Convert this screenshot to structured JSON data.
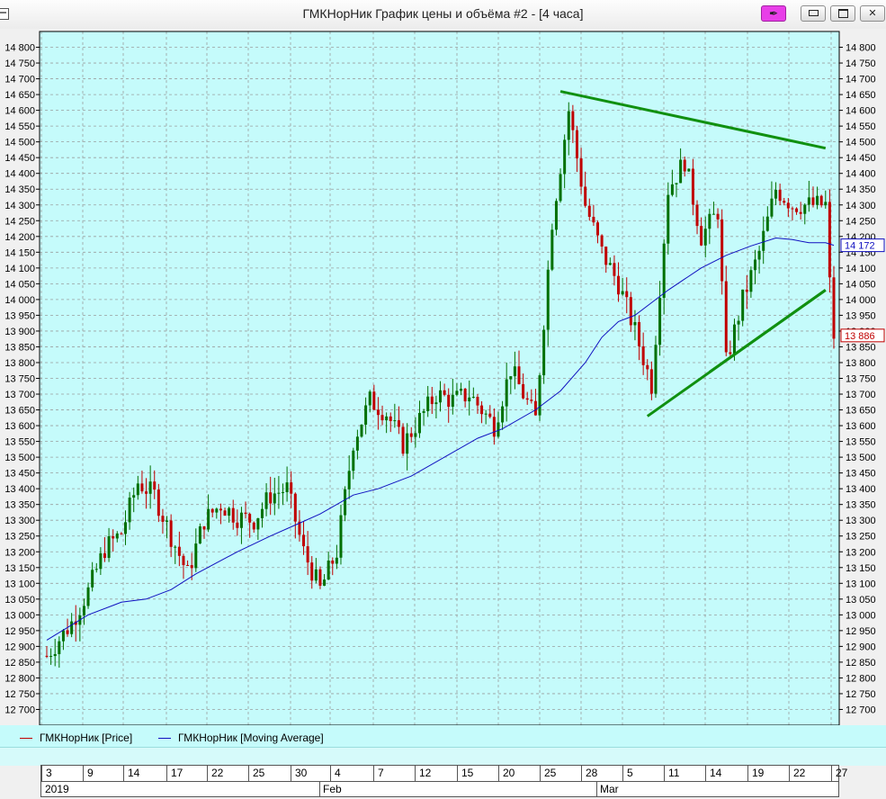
{
  "window": {
    "title": "ГМКНорНик График цены и объёма #2 - [4 часа]",
    "pin_glyph": "✒",
    "controls": [
      "pin-icon",
      "minimize-icon",
      "maximize-icon",
      "close-icon"
    ]
  },
  "colors": {
    "plot_bg": "#c5fbfb",
    "grid": "#9aa0a0",
    "up": "#007000",
    "down": "#c00000",
    "ma": "#1010c0",
    "trend": "#109010",
    "border": "#000000"
  },
  "legend": {
    "price": "ГМКНорНик [Price]",
    "ma": "ГМКНорНик [Moving Average]"
  },
  "time_axis": {
    "day_ticks": [
      "3",
      "9",
      "14",
      "17",
      "22",
      "25",
      "30",
      "4",
      "7",
      "12",
      "15",
      "20",
      "25",
      "28",
      "5",
      "11",
      "14",
      "19",
      "22",
      "27"
    ],
    "months": [
      "2019",
      "Feb",
      "Mar"
    ]
  },
  "chart_data": {
    "type": "candlestick",
    "title": "ГМКНорНик График цены и объёма #2 - [4 часа]",
    "ylim": [
      12650,
      14850
    ],
    "y_ticks": [
      12700,
      12750,
      12800,
      12850,
      12900,
      12950,
      13000,
      13050,
      13100,
      13150,
      13200,
      13250,
      13300,
      13350,
      13400,
      13450,
      13500,
      13550,
      13600,
      13650,
      13700,
      13750,
      13800,
      13850,
      13900,
      13950,
      14000,
      14050,
      14100,
      14150,
      14200,
      14250,
      14300,
      14350,
      14400,
      14450,
      14500,
      14550,
      14600,
      14650,
      14700,
      14750,
      14800
    ],
    "y_tick_labels": [
      "12 700",
      "12 750",
      "12 800",
      "12 850",
      "12 900",
      "12 950",
      "13 000",
      "13 050",
      "13 100",
      "13 150",
      "13 200",
      "13 250",
      "13 300",
      "13 350",
      "13 400",
      "13 450",
      "13 500",
      "13 550",
      "13 600",
      "13 650",
      "13 700",
      "13 750",
      "13 800",
      "13 850",
      "13 900",
      "13 950",
      "14 000",
      "14 050",
      "14 100",
      "14 150",
      "14 200",
      "14 250",
      "14 300",
      "14 350",
      "14 400",
      "14 450",
      "14 500",
      "14 550",
      "14 600",
      "14 650",
      "14 700",
      "14 750",
      "14 800"
    ],
    "grid": true,
    "price_markers": [
      {
        "value": 14172,
        "label": "14 172",
        "series": "ma"
      },
      {
        "value": 13886,
        "label": "13 886",
        "series": "price"
      }
    ],
    "trend_lines": [
      {
        "name": "resistance",
        "from": [
          124,
          14660
        ],
        "to": [
          188,
          14480
        ]
      },
      {
        "name": "support-1",
        "from": [
          145,
          13630
        ],
        "to": [
          188,
          14030
        ]
      },
      {
        "name": "support-2",
        "from": [
          160,
          13770
        ],
        "to": [
          188,
          14030
        ]
      }
    ],
    "series": [
      {
        "name": "ГМКНорНик [Price]",
        "kind": "candles",
        "anchors": [
          [
            0,
            12870
          ],
          [
            6,
            12975
          ],
          [
            10,
            13075
          ],
          [
            14,
            13210
          ],
          [
            18,
            13260
          ],
          [
            22,
            13420
          ],
          [
            26,
            13380
          ],
          [
            30,
            13250
          ],
          [
            34,
            13130
          ],
          [
            38,
            13300
          ],
          [
            42,
            13350
          ],
          [
            46,
            13310
          ],
          [
            50,
            13300
          ],
          [
            54,
            13380
          ],
          [
            58,
            13400
          ],
          [
            62,
            13200
          ],
          [
            66,
            13080
          ],
          [
            70,
            13200
          ],
          [
            74,
            13550
          ],
          [
            78,
            13680
          ],
          [
            82,
            13640
          ],
          [
            86,
            13540
          ],
          [
            90,
            13620
          ],
          [
            94,
            13700
          ],
          [
            98,
            13680
          ],
          [
            102,
            13700
          ],
          [
            108,
            13600
          ],
          [
            112,
            13780
          ],
          [
            118,
            13620
          ],
          [
            122,
            14250
          ],
          [
            126,
            14600
          ],
          [
            130,
            14300
          ],
          [
            134,
            14150
          ],
          [
            138,
            14050
          ],
          [
            142,
            13900
          ],
          [
            146,
            13730
          ],
          [
            150,
            14350
          ],
          [
            154,
            14440
          ],
          [
            158,
            14200
          ],
          [
            162,
            14280
          ],
          [
            164,
            13800
          ],
          [
            168,
            14000
          ],
          [
            172,
            14150
          ],
          [
            176,
            14350
          ],
          [
            180,
            14300
          ],
          [
            184,
            14300
          ],
          [
            188,
            14300
          ],
          [
            189,
            14050
          ],
          [
            190,
            13886
          ]
        ]
      },
      {
        "name": "ГМКНорНик [Moving Average]",
        "kind": "line",
        "points": [
          [
            0,
            12920
          ],
          [
            10,
            13000
          ],
          [
            18,
            13040
          ],
          [
            24,
            13050
          ],
          [
            30,
            13080
          ],
          [
            36,
            13130
          ],
          [
            46,
            13200
          ],
          [
            54,
            13250
          ],
          [
            60,
            13285
          ],
          [
            66,
            13320
          ],
          [
            74,
            13380
          ],
          [
            80,
            13400
          ],
          [
            88,
            13440
          ],
          [
            96,
            13500
          ],
          [
            104,
            13560
          ],
          [
            110,
            13590
          ],
          [
            118,
            13650
          ],
          [
            124,
            13710
          ],
          [
            130,
            13800
          ],
          [
            134,
            13880
          ],
          [
            138,
            13930
          ],
          [
            142,
            13950
          ],
          [
            146,
            13990
          ],
          [
            150,
            14030
          ],
          [
            154,
            14065
          ],
          [
            158,
            14100
          ],
          [
            164,
            14140
          ],
          [
            170,
            14170
          ],
          [
            176,
            14195
          ],
          [
            180,
            14190
          ],
          [
            184,
            14180
          ],
          [
            188,
            14180
          ],
          [
            190,
            14172
          ]
        ]
      }
    ]
  }
}
